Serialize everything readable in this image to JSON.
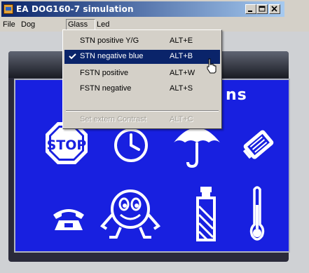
{
  "window": {
    "title": "EA DOG160-7 simulation",
    "controls": [
      "minimize",
      "maximize",
      "close"
    ]
  },
  "menubar": {
    "items": [
      {
        "label": "File"
      },
      {
        "label": "Dog"
      },
      {
        "label": "Glass",
        "open": true
      },
      {
        "label": "Led"
      }
    ]
  },
  "glass_menu": {
    "items": [
      {
        "label": "STN positive Y/G",
        "accel": "ALT+E",
        "checked": false,
        "selected": false,
        "disabled": false
      },
      {
        "label": "STN negative blue",
        "accel": "ALT+B",
        "checked": true,
        "selected": true,
        "disabled": false
      },
      {
        "label": "FSTN positive",
        "accel": "ALT+W",
        "checked": false,
        "selected": false,
        "disabled": false
      },
      {
        "label": "FSTN negative",
        "accel": "ALT+S",
        "checked": false,
        "selected": false,
        "disabled": false
      },
      {
        "label": "Set extern Contrast",
        "accel": "ALT+C",
        "checked": false,
        "selected": false,
        "disabled": true
      }
    ]
  },
  "display": {
    "heading_partial": "ns",
    "stop_text": "STOP",
    "icons_row1": [
      "stop-sign-icon",
      "clock-icon",
      "umbrella-icon",
      "pencil-sharpener-icon"
    ],
    "icons_row2": [
      "telephone-icon",
      "smiley-character-icon",
      "tube-bottle-icon",
      "thermometer-icon"
    ]
  },
  "colors": {
    "titlebar_start": "#0a246a",
    "titlebar_end": "#a6caf0",
    "display_blue": "#1820e0",
    "menu_highlight": "#0a246a",
    "chrome": "#d4d0c8"
  }
}
